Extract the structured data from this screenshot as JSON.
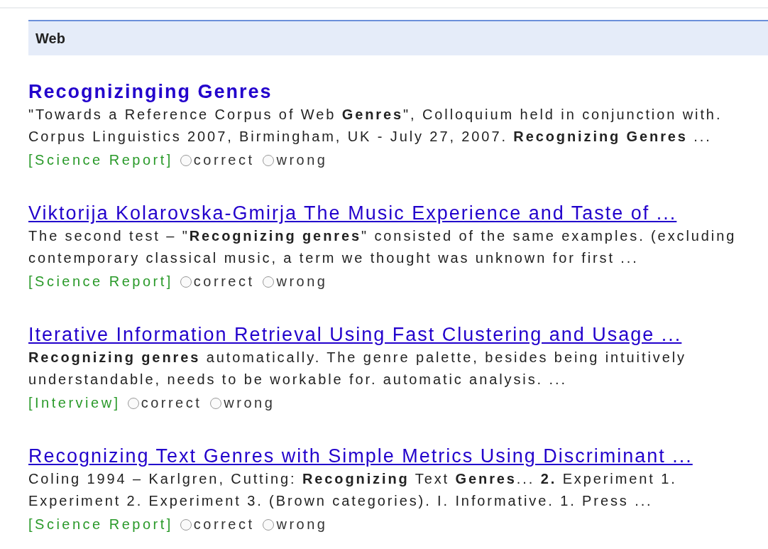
{
  "section_header": {
    "label": "Web"
  },
  "results": [
    {
      "title": "Recognizinging Genres",
      "bold": true,
      "underlined": false,
      "snippet": "\"Towards a Reference Corpus of Web **Genres**\", Colloquium held in conjunction with. Corpus Linguistics 2007, Birmingham, UK - July 27, 2007. **Recognizing Genres** ...",
      "tag": "[Science Report]",
      "options": [
        {
          "label": "correct",
          "selected": false
        },
        {
          "label": "wrong",
          "selected": false
        }
      ]
    },
    {
      "title": "Viktorija Kolarovska-Gmirja The Music Experience and Taste of ...",
      "bold": false,
      "underlined": true,
      "snippet": "The second test – \"**Recognizing genres**\" consisted of the same examples. (excluding contemporary classical music, a term we thought was unknown for first ...",
      "tag": "[Science Report]",
      "options": [
        {
          "label": "correct",
          "selected": false
        },
        {
          "label": "wrong",
          "selected": false
        }
      ]
    },
    {
      "title": "Iterative Information Retrieval Using Fast Clustering and Usage ...",
      "bold": false,
      "underlined": true,
      "snippet": "**Recognizing genres** automatically. The genre palette, besides being intuitively understandable, needs to be workable for. automatic analysis. ...",
      "tag": "[Interview]",
      "options": [
        {
          "label": "correct",
          "selected": false
        },
        {
          "label": "wrong",
          "selected": false
        }
      ]
    },
    {
      "title": "Recognizing Text Genres with Simple Metrics Using Discriminant ...",
      "bold": false,
      "underlined": true,
      "snippet": "Coling 1994 – Karlgren, Cutting: **Recognizing** Text **Genres**... **2.** Experiment 1. Experiment 2. Experiment 3. (Brown categories). I. Informative. 1. Press ...",
      "tag": "[Science Report]",
      "options": [
        {
          "label": "correct",
          "selected": false
        },
        {
          "label": "wrong",
          "selected": false
        }
      ]
    }
  ]
}
